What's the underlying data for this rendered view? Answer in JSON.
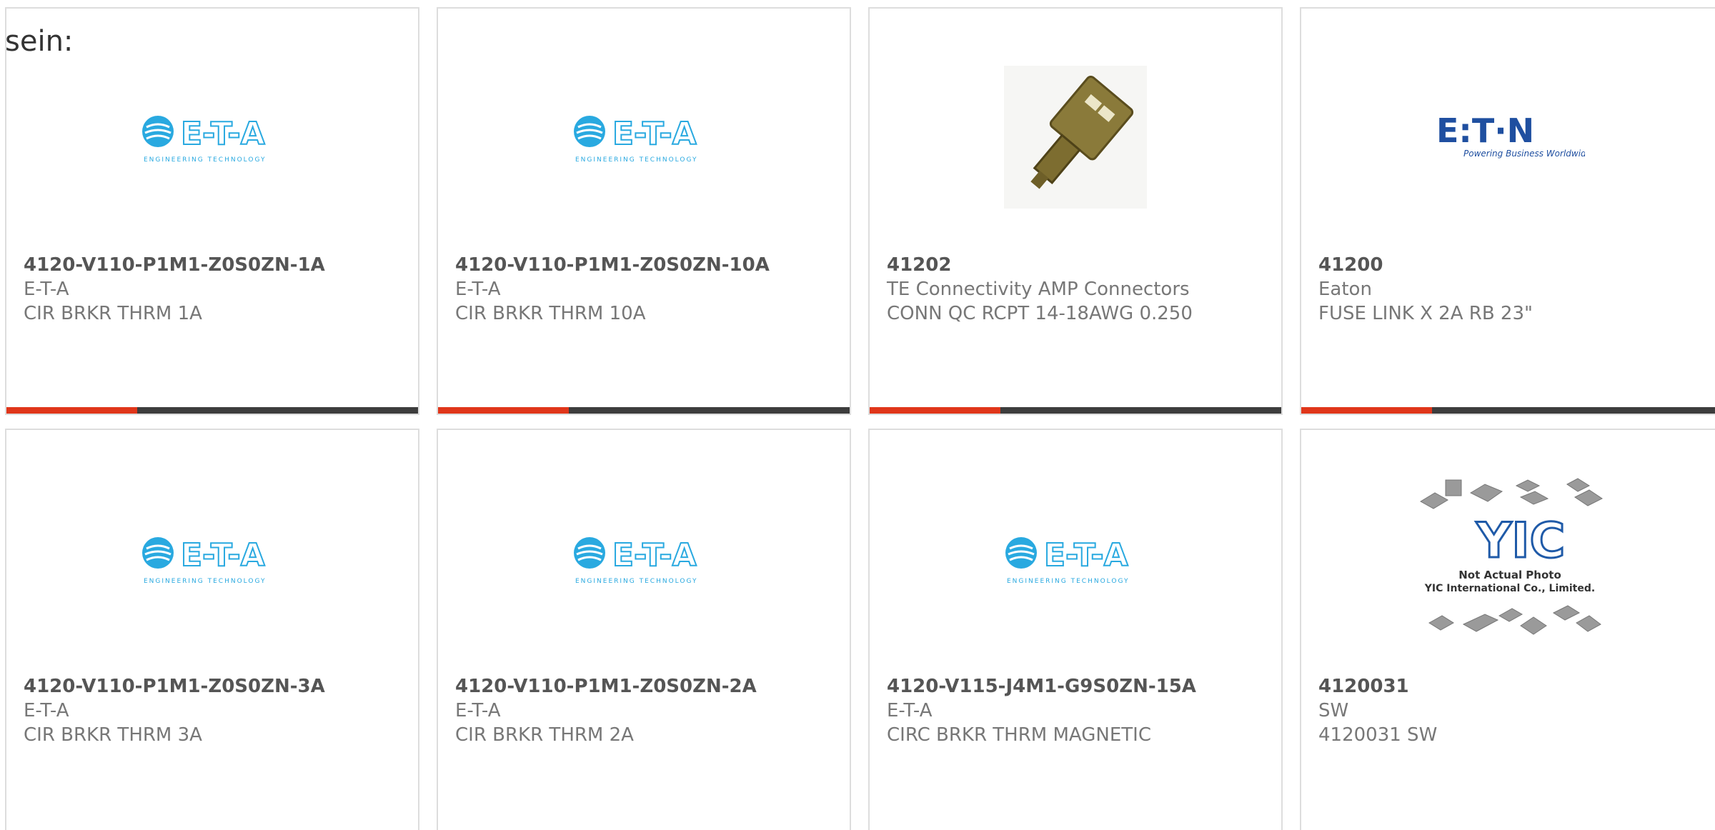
{
  "lead_text": "sein:",
  "colors": {
    "accent": "#e0361a",
    "bar": "#3d3d3d",
    "eta_blue": "#29a9e0",
    "eaton_blue": "#1f4fa0"
  },
  "products": [
    {
      "part_number": "4120-V110-P1M1-Z0S0ZN-1A",
      "manufacturer": "E-T-A",
      "description": "CIR BRKR THRM 1A",
      "image": "eta-logo",
      "logo_text": "E-T-A",
      "logo_tagline": "ENGINEERING TECHNOLOGY"
    },
    {
      "part_number": "4120-V110-P1M1-Z0S0ZN-10A",
      "manufacturer": "E-T-A",
      "description": "CIR BRKR THRM 10A",
      "image": "eta-logo",
      "logo_text": "E-T-A",
      "logo_tagline": "ENGINEERING TECHNOLOGY"
    },
    {
      "part_number": "41202",
      "manufacturer": "TE Connectivity AMP Connectors",
      "description": "CONN QC RCPT 14-18AWG 0.250",
      "image": "connector-photo"
    },
    {
      "part_number": "41200",
      "manufacturer": "Eaton",
      "description": "FUSE LINK X 2A RB 23\"",
      "image": "eaton-logo",
      "logo_text": "E:T·N",
      "logo_tagline": "Powering Business Worldwide"
    },
    {
      "part_number": "4120-V110-P1M1-Z0S0ZN-3A",
      "manufacturer": "E-T-A",
      "description": "CIR BRKR THRM 3A",
      "image": "eta-logo",
      "logo_text": "E-T-A",
      "logo_tagline": "ENGINEERING TECHNOLOGY"
    },
    {
      "part_number": "4120-V110-P1M1-Z0S0ZN-2A",
      "manufacturer": "E-T-A",
      "description": "CIR BRKR THRM 2A",
      "image": "eta-logo",
      "logo_text": "E-T-A",
      "logo_tagline": "ENGINEERING TECHNOLOGY"
    },
    {
      "part_number": "4120-V115-J4M1-G9S0ZN-15A",
      "manufacturer": "E-T-A",
      "description": "CIRC BRKR THRM MAGNETIC",
      "image": "eta-logo",
      "logo_text": "E-T-A",
      "logo_tagline": "ENGINEERING TECHNOLOGY"
    },
    {
      "part_number": "4120031",
      "manufacturer": "SW",
      "description": "4120031 SW",
      "image": "yic-placeholder",
      "logo_text": "YIC",
      "logo_caption_1": "Not Actual Photo",
      "logo_caption_2": "YIC International Co., Limited."
    }
  ]
}
